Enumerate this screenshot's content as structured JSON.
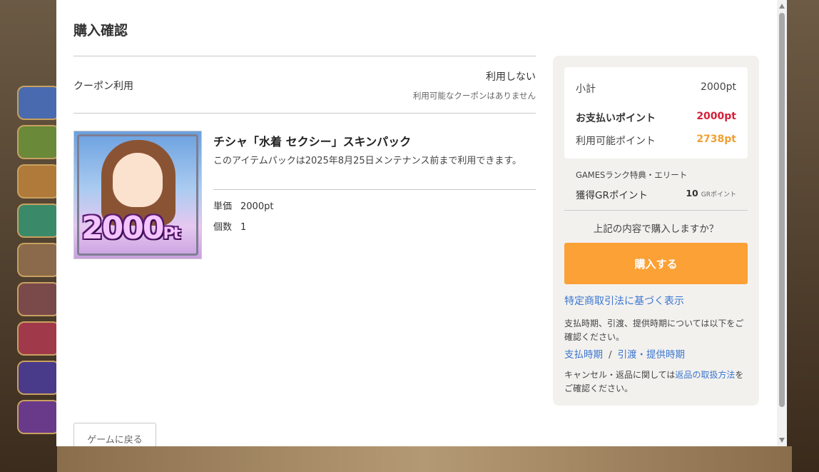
{
  "modal": {
    "title": "購入確認"
  },
  "coupon": {
    "label": "クーポン利用",
    "value": "利用しない",
    "note": "利用可能なクーポンはありません"
  },
  "item": {
    "name": "チシャ「水着 セクシー」スキンパック",
    "description": "このアイテムパックは2025年8月25日メンテナンス前まで利用できます。",
    "image_text": "2000",
    "image_text_unit": "Pt",
    "unit_price_label": "単価",
    "unit_price": "2000pt",
    "quantity_label": "個数",
    "quantity": "1"
  },
  "summary": {
    "subtotal_label": "小計",
    "subtotal": "2000pt",
    "payment_label": "お支払いポイント",
    "payment": "2000pt",
    "available_label": "利用可能ポイント",
    "available": "2738pt",
    "rank_text": "GAMESランク特典・エリート",
    "gr_label": "獲得GRポイント",
    "gr_value": "10",
    "gr_unit": "GRポイント",
    "confirm_question": "上記の内容で購入しますか？",
    "buy_button": "購入する",
    "legal_link": "特定商取引法に基づく表示",
    "pay_note": "支払時期、引渡、提供時期については以下をご確認ください。",
    "link_payment_timing": "支払時期",
    "link_separator": "/",
    "link_delivery": "引渡・提供時期",
    "cancel_note_prefix": "キャンセル・返品に関しては",
    "cancel_link": "返品の取扱方法",
    "cancel_note_suffix": "をご確認ください。"
  },
  "footer": {
    "back_button": "ゲームに戻る"
  },
  "colors": {
    "accent_orange": "#fba135",
    "payment_red": "#d6203a",
    "available_orange": "#f0a030",
    "link_blue": "#3a76d0"
  }
}
